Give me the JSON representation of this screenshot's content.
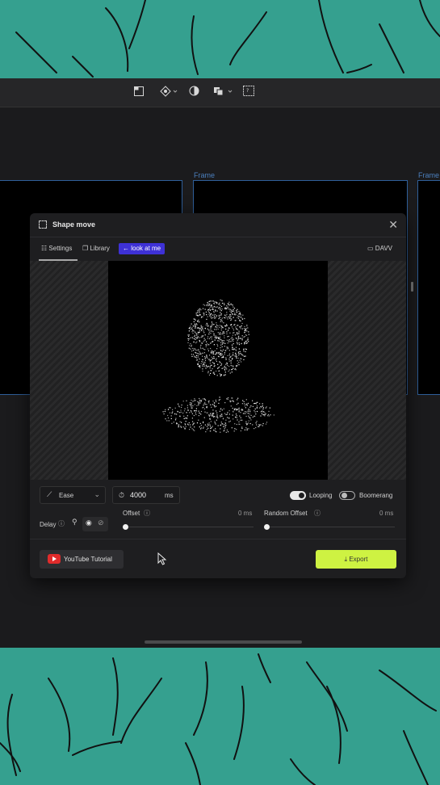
{
  "toolbar": {
    "icons": [
      "page-icon",
      "component-icon",
      "contrast-icon",
      "layers-icon",
      "code-icon"
    ]
  },
  "canvas": {
    "frame_labels": [
      "Frame",
      "Frame"
    ]
  },
  "modal": {
    "title": "Shape move",
    "tabs": {
      "settings": "Settings",
      "library": "Library",
      "tag": "← look at me",
      "right": "DAVV"
    },
    "ease_label": "Ease",
    "duration_value": "4000",
    "duration_unit": "ms",
    "looping_label": "Looping",
    "looping_on": true,
    "boomerang_label": "Boomerang",
    "boomerang_on": false,
    "delay_label": "Delay",
    "offset_label": "Offset",
    "offset_value": "0 ms",
    "random_offset_label": "Random Offset",
    "random_offset_value": "0 ms",
    "youtube_label": "YouTube Tutorial",
    "export_label": "Export"
  },
  "colors": {
    "background": "#35a08f",
    "accent_tag": "#3e31d6",
    "export": "#cef242",
    "youtube": "#e02b2b"
  }
}
